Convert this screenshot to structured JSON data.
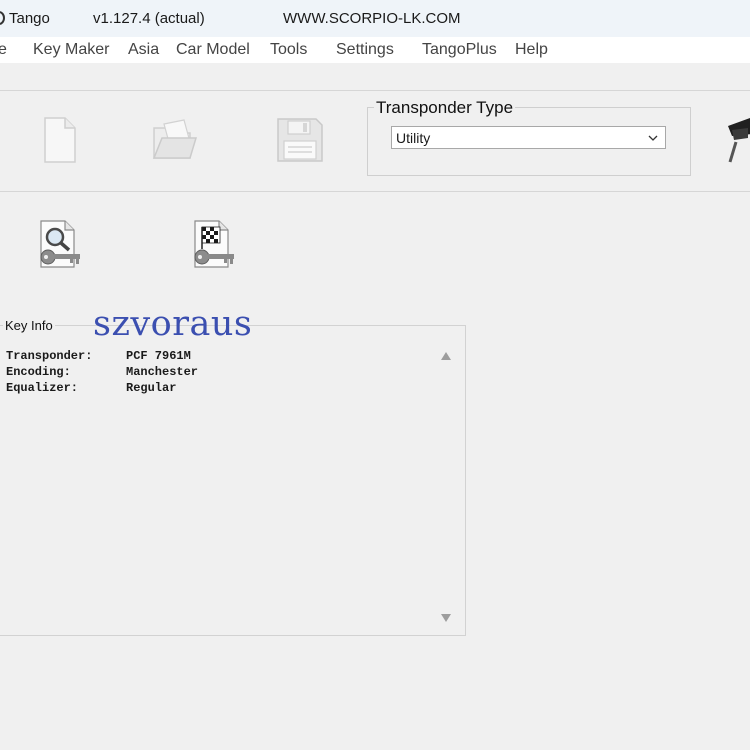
{
  "window": {
    "app_name": "Tango",
    "version": "v1.127.4  (actual)",
    "website": "WWW.SCORPIO-LK.COM"
  },
  "menu": [
    "e",
    "Key Maker",
    "Asia",
    "Car Model",
    "Tools",
    "Settings",
    "TangoPlus",
    "Help"
  ],
  "toolbar": {
    "icons": [
      "new-file-icon",
      "open-folder-icon",
      "save-floppy-icon",
      "graduation-cap-icon"
    ]
  },
  "transponder_type": {
    "label": "Transponder Type",
    "selected": "Utility"
  },
  "key_actions": [
    "key-search-icon",
    "key-checkered-flag-icon"
  ],
  "key_info": {
    "label": "Key Info",
    "rows": [
      {
        "label": "Transponder:",
        "value": "PCF 7961M"
      },
      {
        "label": "Encoding:",
        "value": "Manchester"
      },
      {
        "label": "Equalizer:",
        "value": "Regular"
      }
    ]
  },
  "watermark": "szvoraus",
  "colors": {
    "watermark": "#3b4fb0",
    "background": "#f0f0f0",
    "titlebar": "#eff4f9"
  }
}
